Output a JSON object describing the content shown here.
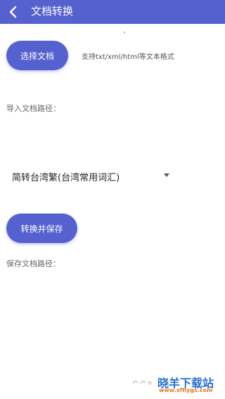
{
  "header": {
    "title": "文档转换"
  },
  "actions": {
    "select_label": "选择文档",
    "hint": "支持txt/xml/html等文本格式",
    "convert_label": "转换并保存"
  },
  "import_path_label": "导入文档路径：",
  "conversion_select": {
    "selected": "简转台湾繁(台湾常用词汇)"
  },
  "save_path_label": "保存文档路径：",
  "watermark": {
    "brand": "晓羊下载站",
    "url": "www.xfhygs.com"
  },
  "colors": {
    "accent": "#5561cf",
    "watermark_blue": "#2a6fd6",
    "watermark_orange": "#e07a1a"
  }
}
